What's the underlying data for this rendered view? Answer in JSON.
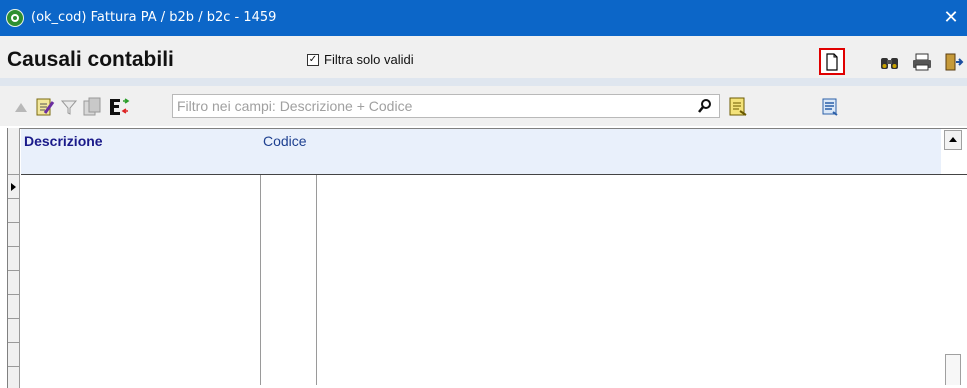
{
  "window": {
    "title": "(ok_cod) Fattura PA / b2b / b2c - 1459",
    "close_glyph": "✕"
  },
  "header": {
    "title": "Causali contabili",
    "filter_checkbox": {
      "label": "Filtra solo validi",
      "checked": true,
      "check_glyph": "✓"
    }
  },
  "toolbar": {
    "buttons": [
      {
        "name": "refresh-arrows-icon"
      },
      {
        "name": "new-document-icon",
        "highlighted": true,
        "highlight_color": "#e00000"
      },
      {
        "name": "binoculars-icon"
      },
      {
        "name": "printer-icon"
      },
      {
        "name": "exit-door-icon"
      }
    ]
  },
  "searchbar": {
    "placeholder": "Filtro nei campi: Descrizione + Codice",
    "value": "",
    "buttons": [
      {
        "name": "move-up-icon"
      },
      {
        "name": "edit-filter-icon"
      },
      {
        "name": "funnel-icon"
      },
      {
        "name": "copy-columns-icon"
      },
      {
        "name": "export-e-icon"
      },
      {
        "name": "search-icon"
      },
      {
        "name": "notes-icon"
      },
      {
        "name": "list-view-icon"
      }
    ]
  },
  "grid": {
    "columns": [
      {
        "label": "Descrizione"
      },
      {
        "label": "Codice"
      }
    ],
    "rows": []
  },
  "colors": {
    "titlebar": "#0c66c8",
    "header_bg": "#e9f0fb",
    "accent_red": "#e00000"
  }
}
